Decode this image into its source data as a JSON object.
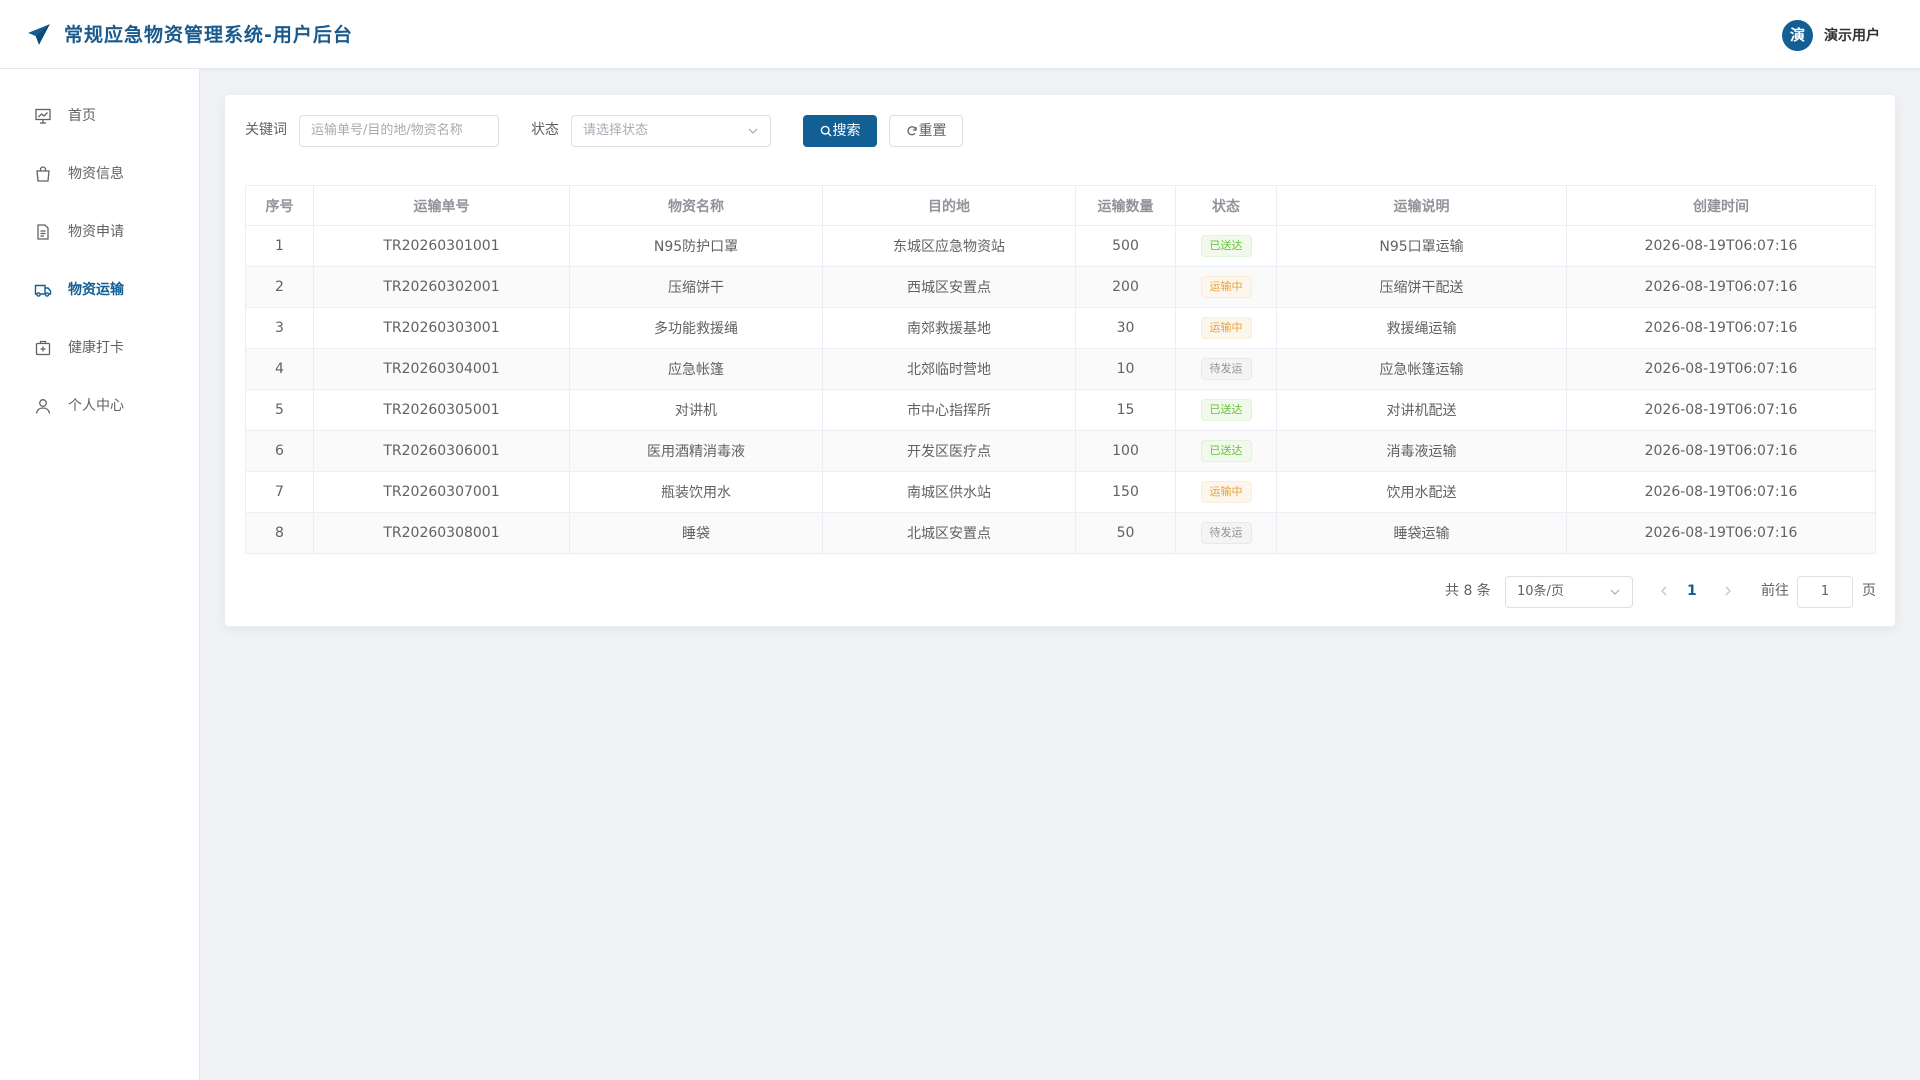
{
  "header": {
    "title": "常规应急物资管理系统-用户后台",
    "avatar_text": "演",
    "username": "演示用户",
    "brand_color": "#125f93"
  },
  "sidebar": {
    "items": [
      {
        "label": "首页",
        "icon": "home-chart-icon",
        "active": false
      },
      {
        "label": "物资信息",
        "icon": "shopping-bag-icon",
        "active": false
      },
      {
        "label": "物资申请",
        "icon": "document-icon",
        "active": false
      },
      {
        "label": "物资运输",
        "icon": "truck-icon",
        "active": true
      },
      {
        "label": "健康打卡",
        "icon": "first-aid-icon",
        "active": false
      },
      {
        "label": "个人中心",
        "icon": "user-icon",
        "active": false
      }
    ]
  },
  "search": {
    "keyword_label": "关键词",
    "keyword_placeholder": "运输单号/目的地/物资名称",
    "status_label": "状态",
    "status_placeholder": "请选择状态",
    "search_button": "搜索",
    "reset_button": "重置"
  },
  "table": {
    "columns": [
      "序号",
      "运输单号",
      "物资名称",
      "目的地",
      "运输数量",
      "状态",
      "运输说明",
      "创建时间"
    ],
    "rows": [
      {
        "index": "1",
        "order_no": "TR20260301001",
        "name": "N95防护口罩",
        "destination": "东城区应急物资站",
        "quantity": "500",
        "status": "已送达",
        "status_type": "success",
        "note": "N95口罩运输",
        "created": "2026-08-19T06:07:16"
      },
      {
        "index": "2",
        "order_no": "TR20260302001",
        "name": "压缩饼干",
        "destination": "西城区安置点",
        "quantity": "200",
        "status": "运输中",
        "status_type": "warning",
        "note": "压缩饼干配送",
        "created": "2026-08-19T06:07:16"
      },
      {
        "index": "3",
        "order_no": "TR20260303001",
        "name": "多功能救援绳",
        "destination": "南郊救援基地",
        "quantity": "30",
        "status": "运输中",
        "status_type": "warning",
        "note": "救援绳运输",
        "created": "2026-08-19T06:07:16"
      },
      {
        "index": "4",
        "order_no": "TR20260304001",
        "name": "应急帐篷",
        "destination": "北郊临时营地",
        "quantity": "10",
        "status": "待发运",
        "status_type": "info",
        "note": "应急帐篷运输",
        "created": "2026-08-19T06:07:16"
      },
      {
        "index": "5",
        "order_no": "TR20260305001",
        "name": "对讲机",
        "destination": "市中心指挥所",
        "quantity": "15",
        "status": "已送达",
        "status_type": "success",
        "note": "对讲机配送",
        "created": "2026-08-19T06:07:16"
      },
      {
        "index": "6",
        "order_no": "TR20260306001",
        "name": "医用酒精消毒液",
        "destination": "开发区医疗点",
        "quantity": "100",
        "status": "已送达",
        "status_type": "success",
        "note": "消毒液运输",
        "created": "2026-08-19T06:07:16"
      },
      {
        "index": "7",
        "order_no": "TR20260307001",
        "name": "瓶装饮用水",
        "destination": "南城区供水站",
        "quantity": "150",
        "status": "运输中",
        "status_type": "warning",
        "note": "饮用水配送",
        "created": "2026-08-19T06:07:16"
      },
      {
        "index": "8",
        "order_no": "TR20260308001",
        "name": "睡袋",
        "destination": "北城区安置点",
        "quantity": "50",
        "status": "待发运",
        "status_type": "info",
        "note": "睡袋运输",
        "created": "2026-08-19T06:07:16"
      }
    ]
  },
  "pagination": {
    "total_text": "共 8 条",
    "page_size": "10条/页",
    "current_page": "1",
    "goto_label": "前往",
    "goto_value": "1",
    "page_suffix": "页"
  }
}
